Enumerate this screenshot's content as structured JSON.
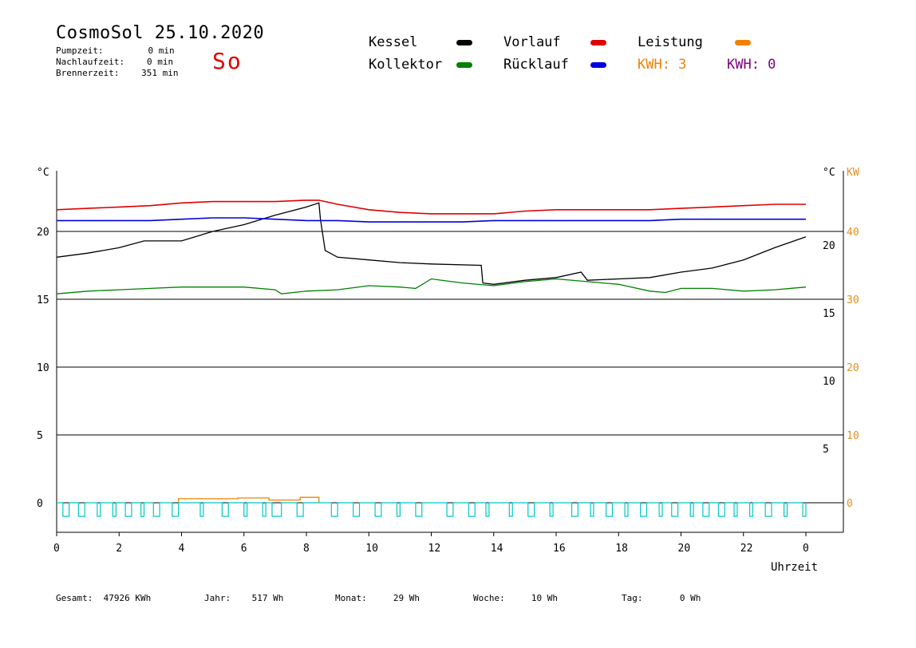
{
  "header": {
    "title": "CosmoSol 25.10.2020",
    "day": "So",
    "pump_label": "Pumpzeit:",
    "pump_value": "0 min",
    "nachlauf_label": "Nachlaufzeit:",
    "nachlauf_value": "0 min",
    "brenner_label": "Brennerzeit:",
    "brenner_value": "351 min"
  },
  "legend": {
    "kessel": "Kessel",
    "kollektor": "Kollektor",
    "vorlauf": "Vorlauf",
    "ruecklauf": "Rücklauf",
    "leistung": "Leistung",
    "kwh1": "KWH: 3",
    "kwh2": "KWH: 0"
  },
  "colors": {
    "kessel": "#000000",
    "kollektor": "#008000",
    "vorlauf": "#e00000",
    "ruecklauf": "#0000e0",
    "leistung": "#f08000",
    "kwh2": "#800080",
    "pump": "#00c8c8",
    "grid": "#000000",
    "axis_right_kw": "#e09020"
  },
  "footer": {
    "gesamt": "Gesamt:  47926 KWh",
    "jahr": "Jahr:    517 Wh",
    "monat": "Monat:     29 Wh",
    "woche": "Woche:     10 Wh",
    "tag": "Tag:       0 Wh"
  },
  "chart_data": {
    "type": "line",
    "xlabel": "Uhrzeit",
    "x_ticks": [
      "0",
      "2",
      "4",
      "6",
      "8",
      "10",
      "12",
      "14",
      "16",
      "18",
      "20",
      "22",
      "0"
    ],
    "xlim": [
      0,
      24
    ],
    "ylim": [
      -2,
      25
    ],
    "y_unit_left": "°C",
    "y_unit_right": "°C",
    "y2_unit": "KW",
    "y_ticks_left": [
      "20",
      "15",
      "10",
      "5",
      "0"
    ],
    "y_ticks_right": [
      "20",
      "15",
      "10",
      "5"
    ],
    "y2_ticks": [
      "40",
      "30",
      "20",
      "10",
      "0"
    ],
    "y_tick_values": [
      20,
      15,
      10,
      5,
      0
    ],
    "grid": true,
    "series": [
      {
        "name": "Kessel",
        "color_key": "kessel",
        "points": [
          [
            0,
            18.1
          ],
          [
            1,
            18.4
          ],
          [
            2,
            18.8
          ],
          [
            2.8,
            19.3
          ],
          [
            4,
            19.3
          ],
          [
            5,
            20
          ],
          [
            6,
            20.5
          ],
          [
            7,
            21.2
          ],
          [
            8,
            21.8
          ],
          [
            8.4,
            22.1
          ],
          [
            8.45,
            20.9
          ],
          [
            8.6,
            18.6
          ],
          [
            9,
            18.1
          ],
          [
            10,
            17.9
          ],
          [
            11,
            17.7
          ],
          [
            12,
            17.6
          ],
          [
            13.6,
            17.5
          ],
          [
            13.65,
            16.2
          ],
          [
            14,
            16.1
          ],
          [
            15,
            16.4
          ],
          [
            16,
            16.6
          ],
          [
            16.8,
            17
          ],
          [
            17,
            16.4
          ],
          [
            18,
            16.5
          ],
          [
            19,
            16.6
          ],
          [
            20,
            17
          ],
          [
            21,
            17.3
          ],
          [
            22,
            17.9
          ],
          [
            23,
            18.8
          ],
          [
            24,
            19.6
          ]
        ]
      },
      {
        "name": "Kollektor",
        "color_key": "kollektor",
        "points": [
          [
            0,
            15.4
          ],
          [
            1,
            15.6
          ],
          [
            2,
            15.7
          ],
          [
            3,
            15.8
          ],
          [
            4,
            15.9
          ],
          [
            5,
            15.9
          ],
          [
            6,
            15.9
          ],
          [
            7,
            15.7
          ],
          [
            7.2,
            15.4
          ],
          [
            8,
            15.6
          ],
          [
            9,
            15.7
          ],
          [
            10,
            16
          ],
          [
            11,
            15.9
          ],
          [
            11.5,
            15.8
          ],
          [
            12,
            16.5
          ],
          [
            13,
            16.2
          ],
          [
            14,
            16
          ],
          [
            15,
            16.3
          ],
          [
            16,
            16.5
          ],
          [
            17,
            16.3
          ],
          [
            18,
            16.1
          ],
          [
            19,
            15.6
          ],
          [
            19.5,
            15.5
          ],
          [
            20,
            15.8
          ],
          [
            21,
            15.8
          ],
          [
            22,
            15.6
          ],
          [
            23,
            15.7
          ],
          [
            24,
            15.9
          ]
        ]
      },
      {
        "name": "Vorlauf",
        "color_key": "vorlauf",
        "points": [
          [
            0,
            21.6
          ],
          [
            1,
            21.7
          ],
          [
            2,
            21.8
          ],
          [
            3,
            21.9
          ],
          [
            4,
            22.1
          ],
          [
            5,
            22.2
          ],
          [
            6,
            22.2
          ],
          [
            7,
            22.2
          ],
          [
            8,
            22.3
          ],
          [
            8.4,
            22.3
          ],
          [
            9,
            22.0
          ],
          [
            10,
            21.6
          ],
          [
            11,
            21.4
          ],
          [
            12,
            21.3
          ],
          [
            13,
            21.3
          ],
          [
            14,
            21.3
          ],
          [
            15,
            21.5
          ],
          [
            16,
            21.6
          ],
          [
            17,
            21.6
          ],
          [
            18,
            21.6
          ],
          [
            19,
            21.6
          ],
          [
            20,
            21.7
          ],
          [
            21,
            21.8
          ],
          [
            22,
            21.9
          ],
          [
            23,
            22.0
          ],
          [
            24,
            22.0
          ]
        ]
      },
      {
        "name": "Rücklauf",
        "color_key": "ruecklauf",
        "points": [
          [
            0,
            20.8
          ],
          [
            3,
            20.8
          ],
          [
            4,
            20.9
          ],
          [
            5,
            21.0
          ],
          [
            6,
            21.0
          ],
          [
            7,
            20.9
          ],
          [
            8,
            20.8
          ],
          [
            9,
            20.8
          ],
          [
            10,
            20.7
          ],
          [
            11,
            20.7
          ],
          [
            12,
            20.7
          ],
          [
            13,
            20.7
          ],
          [
            14,
            20.8
          ],
          [
            15,
            20.8
          ],
          [
            16,
            20.8
          ],
          [
            17,
            20.8
          ],
          [
            18,
            20.8
          ],
          [
            19,
            20.8
          ],
          [
            20,
            20.9
          ],
          [
            21,
            20.9
          ],
          [
            22,
            20.9
          ],
          [
            23,
            20.9
          ],
          [
            24,
            20.9
          ]
        ]
      },
      {
        "name": "Leistung",
        "color_key": "leistung",
        "axis": "kw",
        "points": [
          [
            3.9,
            0
          ],
          [
            3.9,
            0.6
          ],
          [
            5.8,
            0.6
          ],
          [
            5.8,
            0.7
          ],
          [
            6.8,
            0.7
          ],
          [
            6.8,
            0.4
          ],
          [
            7.8,
            0.4
          ],
          [
            7.8,
            0.8
          ],
          [
            8.4,
            0.8
          ],
          [
            8.4,
            0
          ]
        ]
      },
      {
        "name": "Pumpzeit",
        "color_key": "pump",
        "type": "pulse",
        "low": -1.0,
        "high": 0,
        "pulses": [
          [
            0.2,
            0.4
          ],
          [
            0.7,
            0.9
          ],
          [
            1.3,
            1.4
          ],
          [
            1.8,
            1.9
          ],
          [
            2.2,
            2.4
          ],
          [
            2.7,
            2.8
          ],
          [
            3.1,
            3.3
          ],
          [
            3.7,
            3.9
          ],
          [
            4.6,
            4.7
          ],
          [
            5.3,
            5.5
          ],
          [
            6.0,
            6.1
          ],
          [
            6.6,
            6.7
          ],
          [
            6.9,
            7.2
          ],
          [
            7.7,
            7.9
          ],
          [
            8.8,
            9.0
          ],
          [
            9.5,
            9.7
          ],
          [
            10.2,
            10.4
          ],
          [
            10.9,
            11.0
          ],
          [
            11.5,
            11.7
          ],
          [
            12.5,
            12.7
          ],
          [
            13.2,
            13.4
          ],
          [
            13.75,
            13.85
          ],
          [
            14.5,
            14.6
          ],
          [
            15.1,
            15.3
          ],
          [
            15.8,
            15.9
          ],
          [
            16.5,
            16.7
          ],
          [
            17.1,
            17.2
          ],
          [
            17.6,
            17.8
          ],
          [
            18.2,
            18.3
          ],
          [
            18.7,
            18.9
          ],
          [
            19.3,
            19.4
          ],
          [
            19.7,
            19.9
          ],
          [
            20.3,
            20.4
          ],
          [
            20.7,
            20.9
          ],
          [
            21.2,
            21.4
          ],
          [
            21.7,
            21.8
          ],
          [
            22.2,
            22.3
          ],
          [
            22.7,
            22.9
          ],
          [
            23.3,
            23.4
          ],
          [
            23.9,
            24
          ]
        ]
      }
    ]
  }
}
